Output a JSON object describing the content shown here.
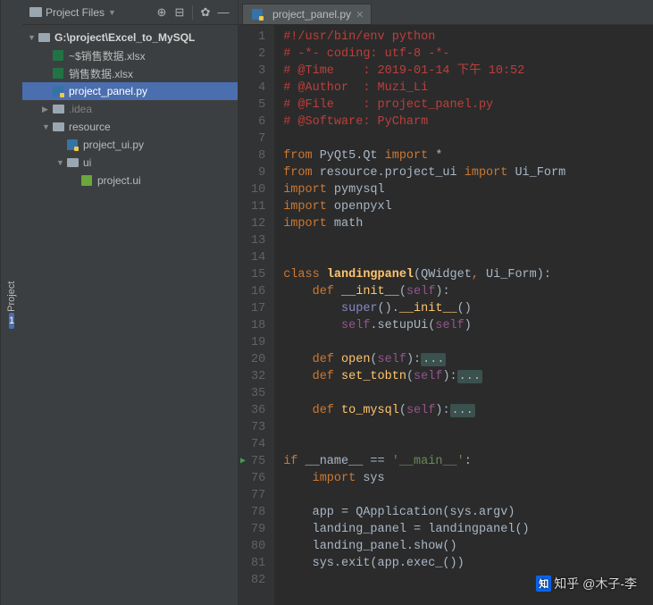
{
  "sidebar_tab": {
    "num": "1",
    "label": "Project"
  },
  "left_header": {
    "title": "Project Files",
    "dropdown_icon": "chevron-down"
  },
  "tree": [
    {
      "level": 0,
      "arrow": "▼",
      "icon": "folder",
      "label": "G:\\project\\Excel_to_MySQL",
      "bold": true,
      "selected": false,
      "interact": true
    },
    {
      "level": 1,
      "arrow": "",
      "icon": "xlsx",
      "label": "~$销售数据.xlsx",
      "selected": false,
      "interact": true
    },
    {
      "level": 1,
      "arrow": "",
      "icon": "xlsx",
      "label": "销售数据.xlsx",
      "selected": false,
      "interact": true
    },
    {
      "level": 1,
      "arrow": "",
      "icon": "pyfile",
      "label": "project_panel.py",
      "selected": true,
      "interact": true
    },
    {
      "level": 1,
      "arrow": "▶",
      "icon": "folder",
      "label": ".idea",
      "muted": true,
      "selected": false,
      "interact": true
    },
    {
      "level": 1,
      "arrow": "▼",
      "icon": "folder",
      "label": "resource",
      "selected": false,
      "interact": true
    },
    {
      "level": 2,
      "arrow": "",
      "icon": "pyfile",
      "label": "project_ui.py",
      "selected": false,
      "interact": true
    },
    {
      "level": 2,
      "arrow": "▼",
      "icon": "folder",
      "label": "ui",
      "selected": false,
      "interact": true
    },
    {
      "level": 3,
      "arrow": "",
      "icon": "uifile",
      "label": "project.ui",
      "selected": false,
      "interact": true
    }
  ],
  "tab": {
    "label": "project_panel.py"
  },
  "line_numbers": [
    1,
    2,
    3,
    4,
    5,
    6,
    7,
    8,
    9,
    10,
    11,
    12,
    13,
    14,
    15,
    16,
    17,
    18,
    19,
    20,
    32,
    35,
    36,
    73,
    74,
    75,
    76,
    77,
    78,
    79,
    80,
    81,
    82
  ],
  "play_lines": [
    75
  ],
  "code": [
    {
      "t": "hdr",
      "s": "#!/usr/bin/env python"
    },
    {
      "t": "hdr",
      "s": "# -*- coding: utf-8 -*-"
    },
    {
      "t": "hdr",
      "s": "# @Time    : 2019-01-14 下午 10:52"
    },
    {
      "t": "hdr",
      "s": "# @Author  : Muzi_Li"
    },
    {
      "t": "hdr",
      "s": "# @File    : project_panel.py"
    },
    {
      "t": "hdr",
      "s": "# @Software: PyCharm"
    },
    {
      "t": "blank",
      "s": ""
    },
    {
      "t": "code",
      "html": "<span class='c-kw'>from</span> PyQt5.Qt <span class='c-kw'>import</span> *"
    },
    {
      "t": "code",
      "html": "<span class='c-kw'>from</span> resource.project_ui <span class='c-kw'>import</span> Ui_Form"
    },
    {
      "t": "code",
      "html": "<span class='c-kw'>import</span> pymysql"
    },
    {
      "t": "code",
      "html": "<span class='c-kw'>import</span> openpyxl"
    },
    {
      "t": "code",
      "html": "<span class='c-kw'>import</span> math"
    },
    {
      "t": "blank",
      "s": ""
    },
    {
      "t": "blank",
      "s": ""
    },
    {
      "t": "code",
      "html": "<span class='c-kw'>class </span><span class='c-decl'>landingpanel</span>(QWidget<span class='c-kw'>, </span>Ui_Form):"
    },
    {
      "t": "code",
      "html": "    <span class='c-kw'>def </span><span class='c-fn'>__init__</span>(<span class='c-self'>self</span>):"
    },
    {
      "t": "code",
      "html": "        <span class='c-builtin'>super</span>().<span class='c-fn'>__init__</span>()"
    },
    {
      "t": "code",
      "html": "        <span class='c-self'>self</span>.setupUi(<span class='c-self'>self</span>)"
    },
    {
      "t": "blank",
      "s": ""
    },
    {
      "t": "code",
      "html": "    <span class='c-kw'>def </span><span class='c-fn'>open</span>(<span class='c-self'>self</span>):<span class='c-dots'>...</span>"
    },
    {
      "t": "code",
      "html": "    <span class='c-kw'>def </span><span class='c-fn'>set_tobtn</span>(<span class='c-self'>self</span>):<span class='c-dots'>...</span>"
    },
    {
      "t": "blank",
      "s": ""
    },
    {
      "t": "code",
      "html": "    <span class='c-kw'>def </span><span class='c-fn'>to_mysql</span>(<span class='c-self'>self</span>):<span class='c-dots'>...</span>"
    },
    {
      "t": "blank",
      "s": ""
    },
    {
      "t": "blank",
      "s": ""
    },
    {
      "t": "code",
      "html": "<span class='c-kw'>if</span> __name__ == <span class='c-str'>'__main__'</span>:"
    },
    {
      "t": "code",
      "html": "    <span class='c-kw'>import</span> sys"
    },
    {
      "t": "blank",
      "s": ""
    },
    {
      "t": "code",
      "html": "    app = QApplication(sys.argv)"
    },
    {
      "t": "code",
      "html": "    landing_panel = landingpanel()"
    },
    {
      "t": "code",
      "html": "    landing_panel.show()"
    },
    {
      "t": "code",
      "html": "    sys.exit(app.exec_())"
    },
    {
      "t": "blank",
      "s": ""
    }
  ],
  "watermark": "知乎 @木子-李"
}
